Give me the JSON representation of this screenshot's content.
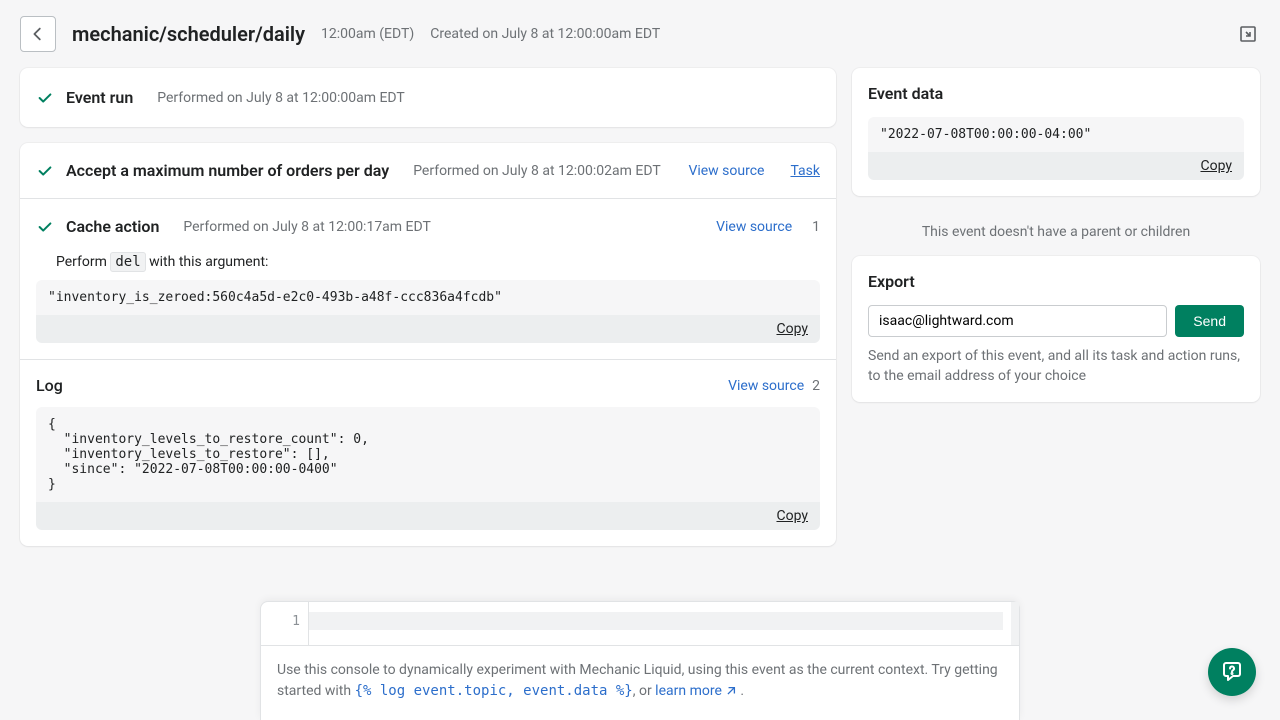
{
  "header": {
    "title": "mechanic/scheduler/daily",
    "time": "12:00am (EDT)",
    "created": "Created on July 8 at 12:00:00am EDT"
  },
  "event_run": {
    "title": "Event run",
    "performed": "Performed on July 8 at 12:00:00am EDT"
  },
  "task_run": {
    "title": "Accept a maximum number of orders per day",
    "performed": "Performed on July 8 at 12:00:02am EDT",
    "view_source": "View source",
    "task_link": "Task"
  },
  "cache_action": {
    "title": "Cache action",
    "performed": "Performed on July 8 at 12:00:17am EDT",
    "view_source": "View source",
    "count": "1",
    "perform_prefix": "Perform ",
    "perform_op": "del",
    "perform_suffix": " with this argument:",
    "argument": "\"inventory_is_zeroed:560c4a5d-e2c0-493b-a48f-ccc836a4fcdb\"",
    "copy": "Copy"
  },
  "log": {
    "title": "Log",
    "view_source": "View source",
    "count": "2",
    "body": "{\n  \"inventory_levels_to_restore_count\": 0,\n  \"inventory_levels_to_restore\": [],\n  \"since\": \"2022-07-08T00:00:00-0400\"\n}",
    "copy": "Copy"
  },
  "event_data": {
    "title": "Event data",
    "body": "\"2022-07-08T00:00:00-04:00\"",
    "copy": "Copy",
    "no_parent": "This event doesn't have a parent or children"
  },
  "export": {
    "title": "Export",
    "email": "isaac@lightward.com",
    "send": "Send",
    "desc": "Send an export of this event, and all its task and action runs, to the email address of your choice"
  },
  "console": {
    "line_no": "1",
    "hint_prefix": "Use this console to dynamically experiment with Mechanic Liquid, using this event as the current context. Try getting started with ",
    "hint_code": "{% log event.topic, event.data %}",
    "hint_mid": ", or ",
    "learn_more": "learn more",
    "hint_suffix": " ."
  }
}
